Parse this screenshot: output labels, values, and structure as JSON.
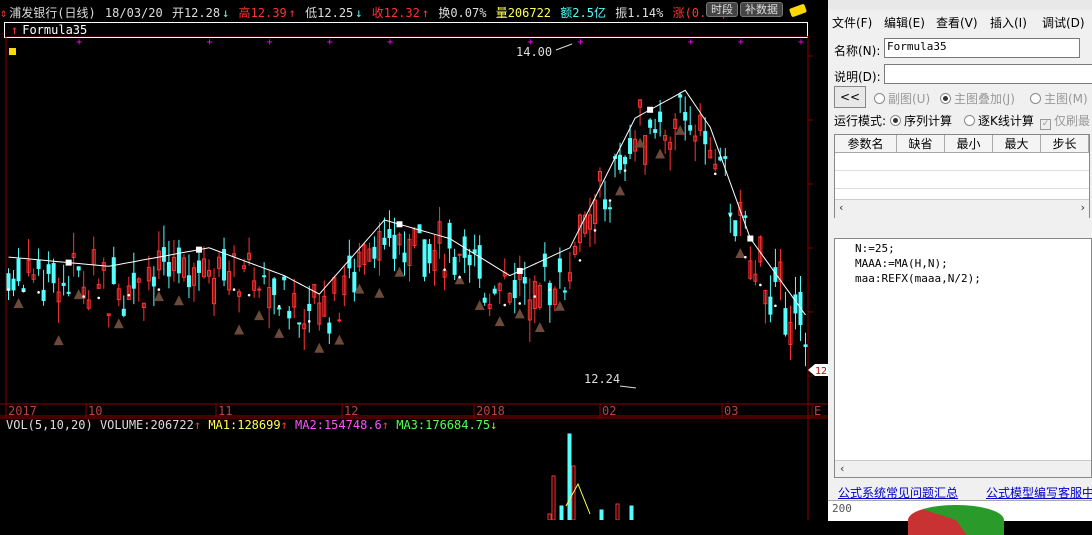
{
  "info_bar": {
    "stock": "浦发银行(日线)",
    "date": "18/03/20",
    "open": "开12.28",
    "high": "高12.39",
    "low": "低12.25",
    "close": "收12.32",
    "turnover": "换0.07%",
    "volume": "量206722",
    "amount": "额2.5亿",
    "amplitude": "振1.14%",
    "change": "涨(0.01)",
    "btn_shiduan": "时段",
    "btn_bushuju": "补数据"
  },
  "formula_name": "Formula35",
  "price_labels": {
    "high": "14.00",
    "low": "12.24",
    "current": "12"
  },
  "x_axis": [
    "2017",
    "10",
    "11",
    "12",
    "2018",
    "02",
    "03",
    "E"
  ],
  "volume_header": {
    "label": "VOL(5,10,20)",
    "volume": "VOLUME:206722",
    "ma1": "MA1:128699",
    "ma2": "MA2:154748.6",
    "ma3": "MA3:176684.75"
  },
  "vol_axis_label": "200",
  "colors": {
    "up": "#ff3232",
    "down": "#54ffff",
    "ma": "#ffffff",
    "marker": "#ff00ff",
    "triangle": "#6b4a3a"
  },
  "panel": {
    "menu": [
      "文件(F)",
      "编辑(E)",
      "查看(V)",
      "插入(I)",
      "调试(D)"
    ],
    "name_label": "名称(N):",
    "name_value": "Formula35",
    "desc_label": "说明(D):",
    "desc_value": "",
    "collapse_btn": "<<",
    "radio_fuyu": "副图(U)",
    "radio_diejia": "主图叠加(J)",
    "radio_zhutu": "主图(M)",
    "run_mode_label": "运行模式:",
    "run_seq": "序列计算",
    "run_kline": "逐K线计算",
    "refresh_only": "仅刷最",
    "table_headers": [
      "参数名",
      "缺省",
      "最小",
      "最大",
      "步长"
    ],
    "code_lines": [
      "N:=25;",
      "MAAA:=MA(H,N);",
      "maa:REFX(maaa,N/2);"
    ],
    "link_faq": "公式系统常见问题汇总",
    "link_service": "公式模型编写客服中"
  }
}
